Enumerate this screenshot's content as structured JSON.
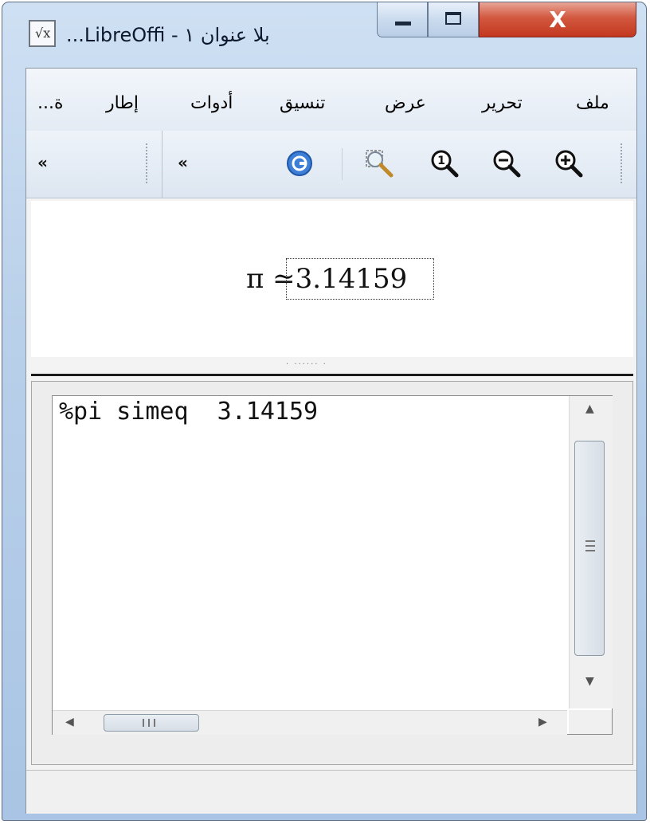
{
  "window": {
    "title": "بلا عنوان ١ - LibreOffi...",
    "close_label": "X"
  },
  "menubar": {
    "items": [
      "ملف",
      "تحرير",
      "عرض",
      "تنسيق",
      "أدوات",
      "إطار",
      "...ة"
    ]
  },
  "toolbar": {
    "overflow_left": "«",
    "overflow_mid": "«",
    "icons": [
      "update-icon",
      "zoom-area-icon",
      "zoom-100-icon",
      "zoom-out-icon",
      "zoom-in-icon"
    ]
  },
  "formula": {
    "symbol": "π",
    "operator": "≃",
    "value": "3.14159"
  },
  "commands": {
    "text": "%pi simeq  3.14159"
  },
  "scroll": {
    "grip": "III"
  }
}
